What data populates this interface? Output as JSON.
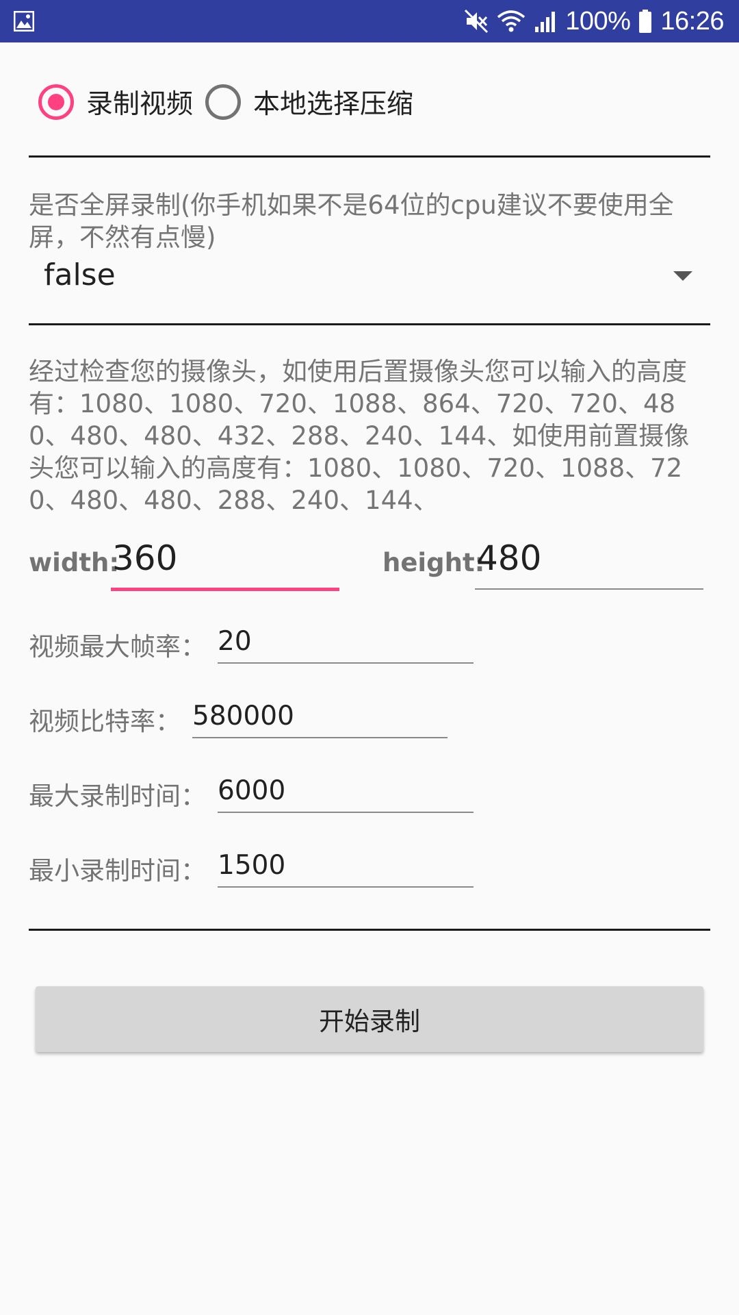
{
  "status_bar": {
    "battery": "100%",
    "time": "16:26",
    "icons": [
      "photo-icon",
      "mute-icon",
      "wifi-icon",
      "signal-icon",
      "battery-icon"
    ]
  },
  "mode": {
    "options": [
      {
        "label": "录制视频",
        "checked": true
      },
      {
        "label": "本地选择压缩",
        "checked": false
      }
    ]
  },
  "fullscreen": {
    "label": "是否全屏录制(你手机如果不是64位的cpu建议不要使用全屏，不然有点慢)",
    "value": "false"
  },
  "camera_info": "经过检查您的摄像头，如使用后置摄像头您可以输入的高度有：1080、1080、720、1088、864、720、720、480、480、480、432、288、240、144、如使用前置摄像头您可以输入的高度有：1080、1080、720、1088、720、480、480、288、240、144、",
  "size": {
    "width_label": "width:",
    "width_value": "360",
    "height_label": "height:",
    "height_value": "480"
  },
  "params": {
    "max_fps_label": "视频最大帧率：",
    "max_fps_value": "20",
    "bitrate_label": "视频比特率：",
    "bitrate_value": "580000",
    "max_time_label": "最大录制时间：",
    "max_time_value": "6000",
    "min_time_label": "最小录制时间：",
    "min_time_value": "1500"
  },
  "start_button": "开始录制",
  "colors": {
    "status_bar": "#303f9f",
    "accent": "#ff4081",
    "button": "#d6d6d6"
  }
}
